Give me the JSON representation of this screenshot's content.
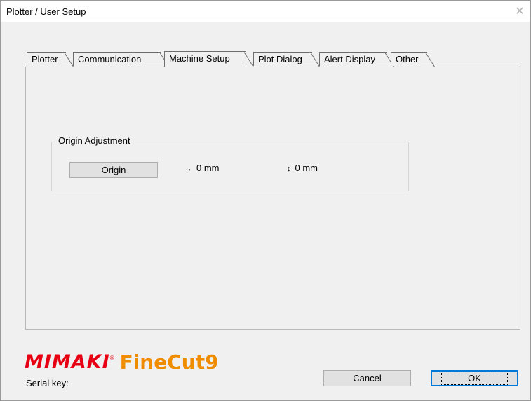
{
  "window": {
    "title": "Plotter / User Setup",
    "close_glyph": "✕"
  },
  "tabs": [
    {
      "label": "Plotter",
      "active": false
    },
    {
      "label": "Communication",
      "active": false
    },
    {
      "label": "Machine Setup",
      "active": true
    },
    {
      "label": "Plot Dialog",
      "active": false
    },
    {
      "label": "Alert Display",
      "active": false
    },
    {
      "label": "Other",
      "active": false
    }
  ],
  "origin_group": {
    "label": "Origin Adjustment",
    "button_label": "Origin",
    "x_arrow": "↔",
    "x_value": "0 mm",
    "y_arrow": "↕",
    "y_value": "0 mm"
  },
  "logo": {
    "brand": "MIMAKI",
    "tm": "®",
    "product": "FineCut9"
  },
  "footer": {
    "serial_label": "Serial key:",
    "cancel_label": "Cancel",
    "ok_label": "OK"
  },
  "colors": {
    "brand_red": "#e60012",
    "brand_orange": "#f08c00",
    "focus_blue": "#0078d7"
  }
}
